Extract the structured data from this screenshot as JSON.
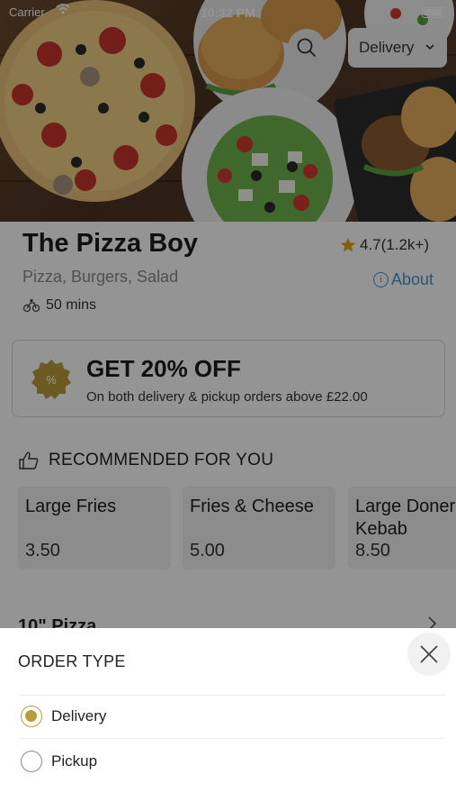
{
  "status_bar": {
    "carrier": "Carrier",
    "time": "10:32 PM"
  },
  "header": {
    "order_type_selector": "Delivery"
  },
  "restaurant": {
    "name": "The Pizza Boy",
    "rating": "4.7(1.2k+)",
    "cuisines": "Pizza, Burgers, Salad",
    "about_label": "About",
    "delivery_time": "50 mins"
  },
  "offer": {
    "title": "GET 20% OFF",
    "subtitle": "On both delivery & pickup orders above £22.00",
    "badge_icon": "percent-badge-icon",
    "badge_color": "#b89e3b"
  },
  "recommended": {
    "heading": "RECOMMENDED FOR YOU",
    "items": [
      {
        "name": "Large Fries",
        "price": "3.50"
      },
      {
        "name": "Fries & Cheese",
        "price": "5.00"
      },
      {
        "name": "Large Doner\nKebab",
        "price": "8.50"
      }
    ]
  },
  "menu": {
    "next_section": "10\" Pizza"
  },
  "order_type_sheet": {
    "title": "ORDER TYPE",
    "options": [
      {
        "label": "Delivery",
        "selected": true
      },
      {
        "label": "Pickup",
        "selected": false
      }
    ],
    "accent_color": "#b89e3b"
  }
}
